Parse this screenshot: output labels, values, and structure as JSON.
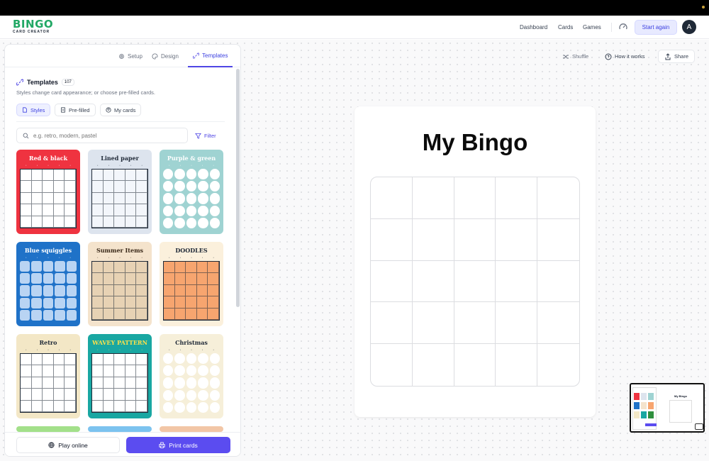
{
  "brand": {
    "name": "BINGO",
    "tagline": "CARD CREATOR",
    "color": "#22a865"
  },
  "nav": {
    "dashboard": "Dashboard",
    "cards": "Cards",
    "games": "Games",
    "start_again": "Start again",
    "avatar_initial": "A"
  },
  "panel": {
    "tabs": [
      {
        "label": "Setup",
        "icon": "gear-icon"
      },
      {
        "label": "Design",
        "icon": "palette-icon"
      },
      {
        "label": "Templates",
        "icon": "link-icon",
        "active": true
      }
    ],
    "templates_title": "Templates",
    "templates_count": "107",
    "description": "Styles change card appearance; or choose pre-filled cards.",
    "segments": [
      {
        "label": "Styles",
        "icon": "file-icon",
        "active": true
      },
      {
        "label": "Pre-filled",
        "icon": "doc-icon"
      },
      {
        "label": "My cards",
        "icon": "user-circle-icon"
      }
    ],
    "search_placeholder": "e.g. retro, modern, pastel",
    "filter_label": "Filter",
    "templates": [
      {
        "name": "Red & black",
        "bg": "#ef3340",
        "title_color": "#ffffff",
        "cell": "#ffffff",
        "style": "square"
      },
      {
        "name": "Lined paper",
        "bg": "#dde4ee",
        "title_color": "#1f2937",
        "cell": "#f3f6fb",
        "style": "square"
      },
      {
        "name": "Purple & green",
        "bg": "#9fd3d2",
        "title_color": "#ffffff",
        "cell": "#ffffff",
        "style": "circle"
      },
      {
        "name": "Blue squiggles",
        "bg": "#1f72c8",
        "title_color": "#ffffff",
        "cell": "#b9d4f3",
        "style": "rounded"
      },
      {
        "name": "Summer Items",
        "bg": "#f4e3cc",
        "title_color": "#3b2a1a",
        "cell": "#e7d2b4",
        "style": "square"
      },
      {
        "name": "DOODLES",
        "bg": "#fbf0dc",
        "title_color": "#1f2937",
        "cell": "#f7a56f",
        "style": "square"
      },
      {
        "name": "Retro",
        "bg": "#f3e7c6",
        "title_color": "#1f2937",
        "cell": "#ffffff",
        "style": "square"
      },
      {
        "name": "WAVEY PATTERN",
        "bg": "#19a7a2",
        "title_color": "#ffe04a",
        "cell": "#ffffff",
        "style": "square"
      },
      {
        "name": "Christmas",
        "bg": "#f6efd9",
        "title_color": "#1f2937",
        "cell": "#ffffff",
        "style": "circle"
      }
    ],
    "play_online": "Play online",
    "print_cards": "Print cards"
  },
  "toolbar": {
    "shuffle": "Shuffle",
    "how_it_works": "How it works",
    "share": "Share"
  },
  "board": {
    "title": "My Bingo",
    "size": "5x5"
  },
  "minimap": {
    "title": "My Bingo"
  }
}
